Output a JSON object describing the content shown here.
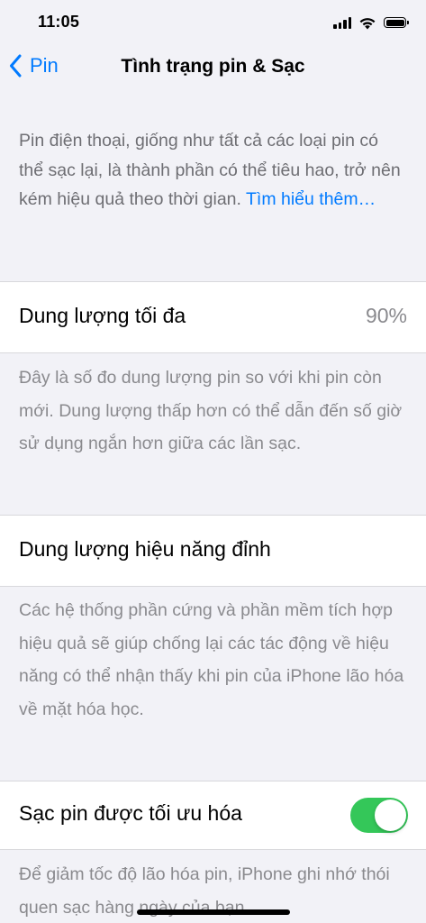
{
  "status_bar": {
    "time": "11:05",
    "icons": [
      "cellular-signal-icon",
      "wifi-icon",
      "battery-icon"
    ]
  },
  "nav": {
    "back_label": "Pin",
    "title": "Tình trạng pin & Sạc",
    "back_icon": "chevron-left-icon"
  },
  "intro": {
    "text": "Pin điện thoại, giống như tất cả các loại pin có thể sạc lại, là thành phần có thể tiêu hao, trở nên kém hiệu quả theo thời gian. ",
    "link": "Tìm hiểu thêm…"
  },
  "max_capacity": {
    "label": "Dung lượng tối đa",
    "value": "90%",
    "footnote": "Đây là số đo dung lượng pin so với khi pin còn mới. Dung lượng thấp hơn có thể dẫn đến số giờ sử dụng ngắn hơn giữa các lần sạc."
  },
  "peak_performance": {
    "label": "Dung lượng hiệu năng đỉnh",
    "footnote": "Các hệ thống phần cứng và phần mềm tích hợp hiệu quả sẽ giúp chống lại các tác động về hiệu năng có thể nhận thấy khi pin của iPhone lão hóa về mặt hóa học."
  },
  "optimized_charging": {
    "label": "Sạc pin được tối ưu hóa",
    "enabled": true,
    "footnote": "Để giảm tốc độ lão hóa pin, iPhone ghi nhớ thói quen sạc hàng ngày của bạn"
  },
  "colors": {
    "accent": "#007aff",
    "toggle_on": "#34c759",
    "background": "#f2f2f7",
    "secondary_text": "#8a8a8e"
  }
}
